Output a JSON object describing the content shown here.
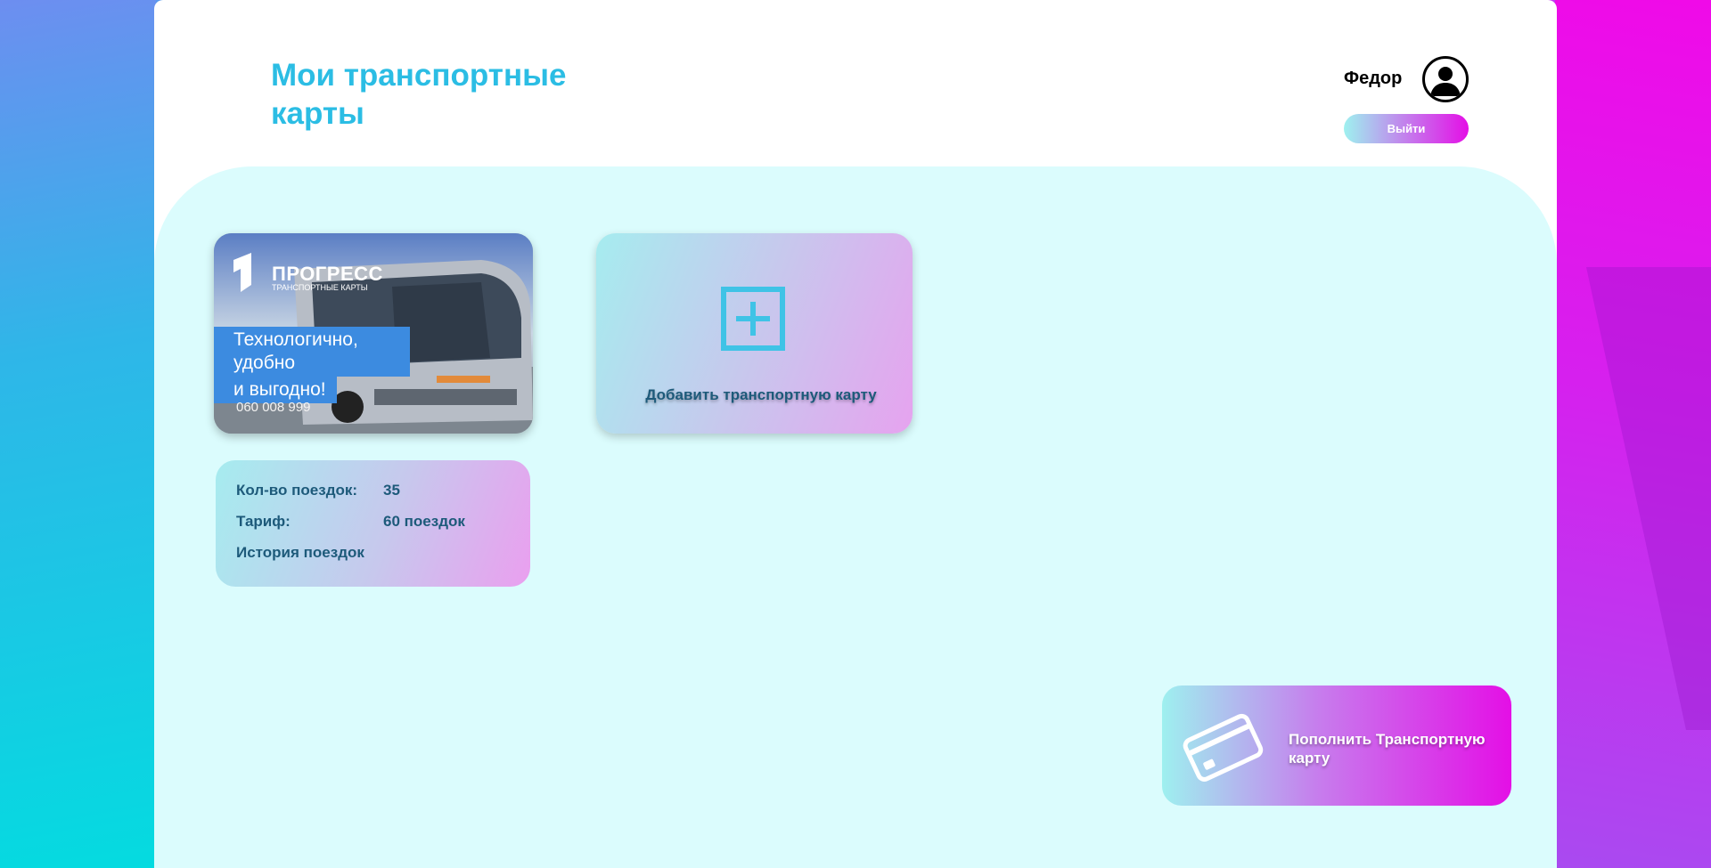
{
  "header": {
    "title": "Мои транспортные карты",
    "user_name": "Федор",
    "logout_label": "Выйти"
  },
  "card": {
    "brand_name": "ПРОГРЕСС",
    "brand_subtitle": "ТРАНСПОРТНЫЕ КАРТЫ",
    "slogan_line1": "Технологично, удобно",
    "slogan_line2": "и выгодно!",
    "number": "060 008 999"
  },
  "add_card": {
    "label": "Добавить транспортную карту"
  },
  "card_info": {
    "trips_label": "Кол-во поездок:",
    "trips_value": "35",
    "tariff_label": "Тариф:",
    "tariff_value": "60 поездок",
    "history_label": "История поездок"
  },
  "topup": {
    "label": "Пополнить Транспортную карту"
  },
  "icons": {
    "avatar": "user-avatar-icon",
    "add": "plus-square-icon",
    "topup": "credit-card-icon"
  },
  "colors": {
    "accent": "#2bbde4",
    "content_bg": "#dbfcfd",
    "text_dark": "#1d5a7a",
    "gradient_start": "#9ef0ef",
    "gradient_end": "#e40fe6"
  }
}
